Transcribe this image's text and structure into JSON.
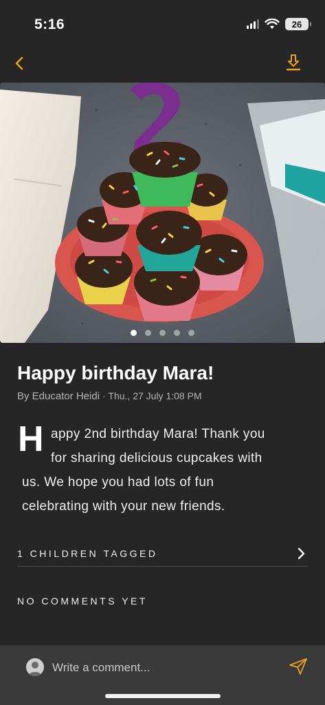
{
  "status_bar": {
    "time": "5:16",
    "battery": "26",
    "icons": [
      "cellular-signal-icon",
      "wifi-icon",
      "battery-icon"
    ]
  },
  "nav": {
    "back_icon": "chevron-left-icon",
    "download_icon": "download-icon",
    "accent_color": "#f0a020"
  },
  "photo": {
    "slide_count": 5,
    "active_slide": 1
  },
  "post": {
    "title": "Happy birthday Mara!",
    "author": "By Educator Heidi",
    "separator": "·",
    "date": "Thu., 27 July 1:08 PM",
    "dropcap": "H",
    "body_lines": [
      "appy 2nd birthday Mara! Thank you",
      "for sharing delicious cupcakes with",
      "us. We hope you had lots of fun",
      "celebrating with your new friends."
    ]
  },
  "tagged": {
    "label": "1 CHILDREN TAGGED",
    "icon": "chevron-right-icon"
  },
  "comments": {
    "label": "NO COMMENTS YET"
  },
  "comment_bar": {
    "placeholder": "Write a comment...",
    "avatar_icon": "user-avatar-icon",
    "send_icon": "send-icon"
  }
}
